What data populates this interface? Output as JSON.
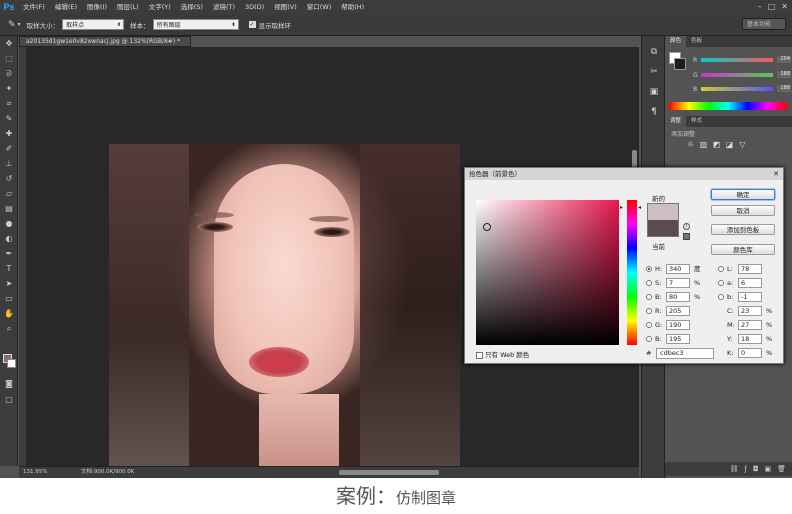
{
  "app": {
    "logo": "Ps"
  },
  "menu": [
    "文件(F)",
    "编辑(E)",
    "图像(I)",
    "图层(L)",
    "文字(Y)",
    "选择(S)",
    "滤镜(T)",
    "3D(D)",
    "视图(V)",
    "窗口(W)",
    "帮助(H)"
  ],
  "options": {
    "sample_size_label": "取样大小：",
    "sample_size_value": "取样点",
    "sample_label": "样本：",
    "sample_value": "所有图层",
    "show_ring_label": "显示取样环",
    "workspace": "基本功能"
  },
  "document": {
    "tab": "a20135d1gw1e0v82xwnacj.jpg @ 132%(RGB/8#) *",
    "zoom": "131.95%",
    "doc_size": "文档:900.0K/900.0K"
  },
  "panels": {
    "color_tabs": [
      "颜色",
      "色板"
    ],
    "color_values": {
      "r": "204",
      "g": "188",
      "b": "188"
    },
    "adjust_tabs": [
      "调整",
      "样式"
    ],
    "adjust_title": "添加调整"
  },
  "picker": {
    "title": "拾色器（前景色）",
    "new_label": "新的",
    "current_label": "当前",
    "ok": "确定",
    "cancel": "取消",
    "add_swatch": "添加到色板",
    "libraries": "颜色库",
    "web_only": "只有 Web 颜色",
    "hsb": [
      {
        "k": "H:",
        "v": "340",
        "u": "度"
      },
      {
        "k": "S:",
        "v": "7",
        "u": "%"
      },
      {
        "k": "B:",
        "v": "80",
        "u": "%"
      }
    ],
    "rgb": [
      {
        "k": "R:",
        "v": "205"
      },
      {
        "k": "G:",
        "v": "190"
      },
      {
        "k": "B:",
        "v": "195"
      }
    ],
    "lab": [
      {
        "k": "L:",
        "v": "78"
      },
      {
        "k": "a:",
        "v": "6"
      },
      {
        "k": "b:",
        "v": "-1"
      }
    ],
    "cmyk": [
      {
        "k": "C:",
        "v": "23",
        "u": "%"
      },
      {
        "k": "M:",
        "v": "27",
        "u": "%"
      },
      {
        "k": "Y:",
        "v": "18",
        "u": "%"
      },
      {
        "k": "K:",
        "v": "0",
        "u": "%"
      }
    ],
    "hex_label": "#",
    "hex": "cdbec3",
    "new_color": "#cdbec3",
    "current_color": "#5b4a4f"
  },
  "caption": {
    "main": "案例：",
    "sub": "仿制图章"
  }
}
